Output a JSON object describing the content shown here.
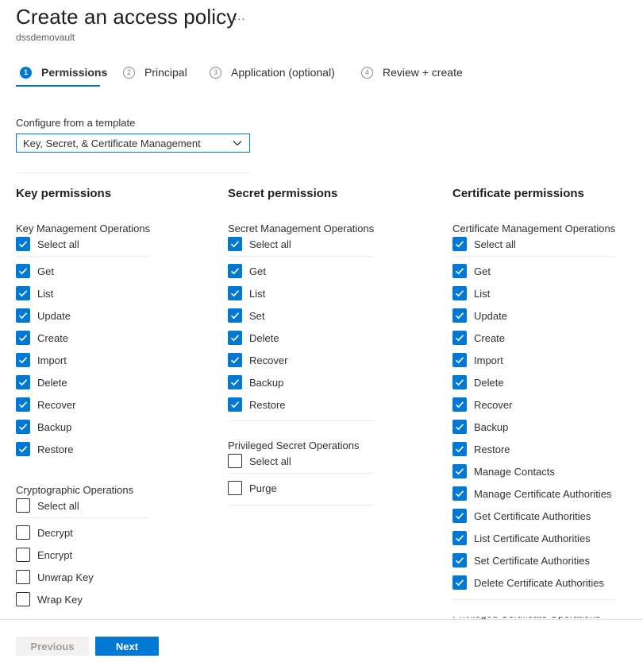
{
  "header": {
    "title": "Create an access policy",
    "more": "...",
    "subtitle": "dssdemovault"
  },
  "steps": [
    {
      "num": "1",
      "label": "Permissions",
      "active": true
    },
    {
      "num": "2",
      "label": "Principal",
      "active": false
    },
    {
      "num": "3",
      "label": "Application (optional)",
      "active": false
    },
    {
      "num": "4",
      "label": "Review + create",
      "active": false
    }
  ],
  "template": {
    "label": "Configure from a template",
    "value": "Key, Secret, & Certificate Management"
  },
  "key": {
    "heading": "Key permissions",
    "mgmt": {
      "title": "Key Management Operations",
      "select_all": "Select all",
      "items": [
        "Get",
        "List",
        "Update",
        "Create",
        "Import",
        "Delete",
        "Recover",
        "Backup",
        "Restore"
      ]
    },
    "crypto": {
      "title": "Cryptographic Operations",
      "select_all": "Select all",
      "items": [
        "Decrypt",
        "Encrypt",
        "Unwrap Key",
        "Wrap Key"
      ]
    }
  },
  "secret": {
    "heading": "Secret permissions",
    "mgmt": {
      "title": "Secret Management Operations",
      "select_all": "Select all",
      "items": [
        "Get",
        "List",
        "Set",
        "Delete",
        "Recover",
        "Backup",
        "Restore"
      ]
    },
    "priv": {
      "title": "Privileged Secret Operations",
      "select_all": "Select all",
      "items": [
        "Purge"
      ]
    }
  },
  "cert": {
    "heading": "Certificate permissions",
    "mgmt": {
      "title": "Certificate Management Operations",
      "select_all": "Select all",
      "items": [
        "Get",
        "List",
        "Update",
        "Create",
        "Import",
        "Delete",
        "Recover",
        "Backup",
        "Restore",
        "Manage Contacts",
        "Manage Certificate Authorities",
        "Get Certificate Authorities",
        "List Certificate Authorities",
        "Set Certificate Authorities",
        "Delete Certificate Authorities"
      ]
    },
    "next_section": "Privileged Certificate Operations"
  },
  "footer": {
    "previous": "Previous",
    "next": "Next"
  },
  "colors": {
    "accent": "#0078d4",
    "text": "#323130",
    "muted": "#605e5c"
  }
}
